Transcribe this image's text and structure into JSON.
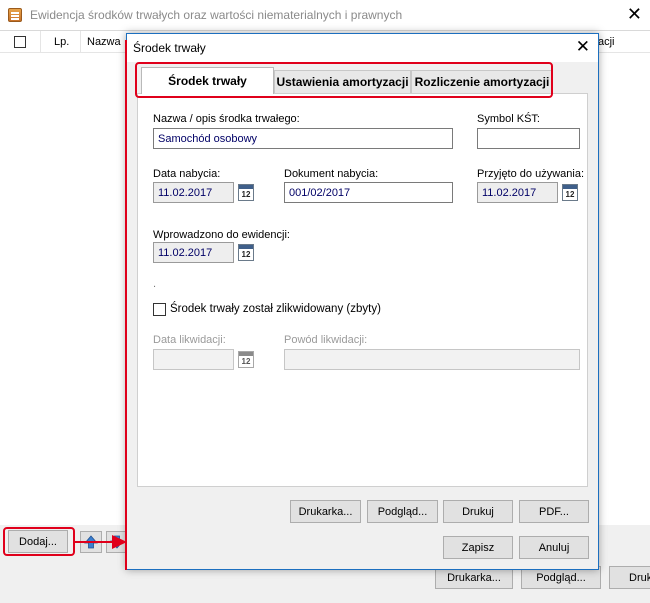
{
  "main": {
    "title": "Ewidencja środków trwałych oraz wartości niematerialnych i prawnych",
    "columns": {
      "lp": "Lp.",
      "nazwa": "Nazwa",
      "partial_right": "acji"
    },
    "buttons": {
      "dodaj": "Dodaj...",
      "drukarka": "Drukarka...",
      "podglad": "Podgląd...",
      "druk_partial": "Druk"
    }
  },
  "dialog": {
    "title": "Środek trwały",
    "tabs": [
      "Środek trwały",
      "Ustawienia amortyzacji",
      "Rozliczenie amortyzacji"
    ],
    "fields": {
      "nazwa_label": "Nazwa / opis środka trwałego:",
      "nazwa_value": "Samochód osobowy",
      "symbol_label": "Symbol KŚT:",
      "symbol_value": "",
      "data_nabycia_label": "Data nabycia:",
      "data_nabycia_value": "11.02.2017",
      "dokument_label": "Dokument nabycia:",
      "dokument_value": "001/02/2017",
      "przyjeto_label": "Przyjęto do używania:",
      "przyjeto_value": "11.02.2017",
      "wprowadzono_label": "Wprowadzono do ewidencji:",
      "wprowadzono_value": "11.02.2017",
      "dot": ".",
      "zlikwidowany_label": "Środek trwały został zlikwidowany (zbyty)",
      "data_likwidacji_label": "Data likwidacji:",
      "data_likwidacji_value": "",
      "powod_label": "Powód likwidacji:",
      "powod_value": "",
      "calendar_day": "12"
    },
    "buttons": {
      "drukarka": "Drukarka...",
      "podglad": "Podgląd...",
      "drukuj": "Drukuj",
      "pdf": "PDF...",
      "zapisz": "Zapisz",
      "anuluj": "Anuluj"
    }
  },
  "colors": {
    "highlight": "#e0001b",
    "value_text": "#000066",
    "dialog_border": "#1c6fbf"
  },
  "icons": [
    "app-icon",
    "close-icon",
    "calendar-icon",
    "arrow-up-icon",
    "arrow-down-icon"
  ]
}
